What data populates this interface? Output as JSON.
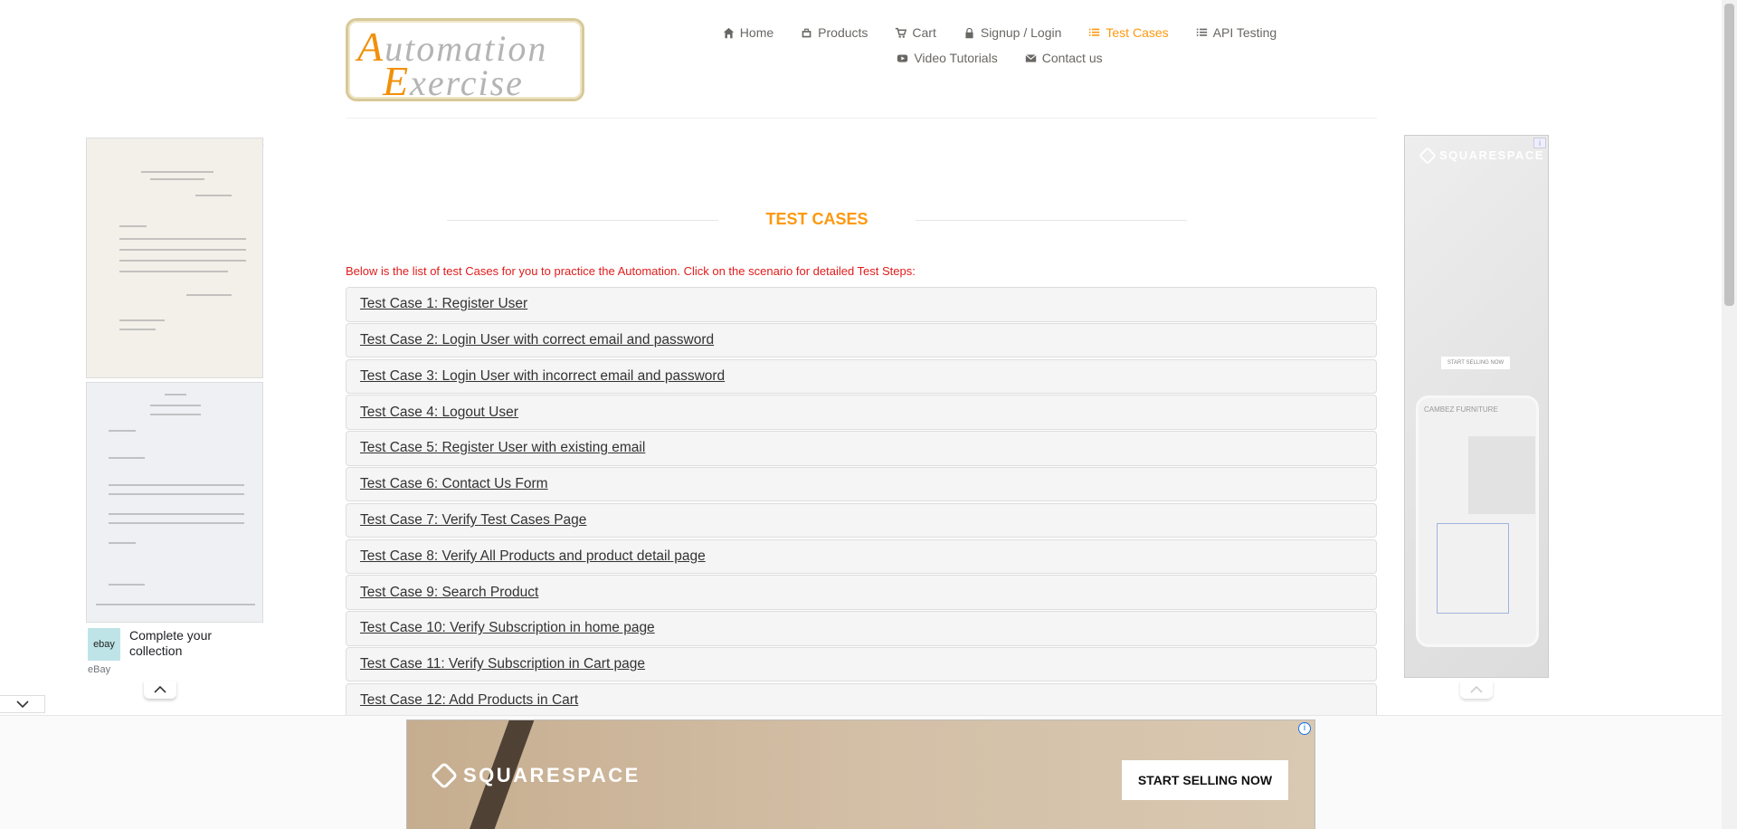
{
  "logo": {
    "line1_cap": "A",
    "line1_rest": "utomation",
    "line2_cap": "E",
    "line2_rest": "xercise"
  },
  "nav": {
    "row1": [
      {
        "label": "Home",
        "icon": "home-icon"
      },
      {
        "label": "Products",
        "icon": "products-icon"
      },
      {
        "label": "Cart",
        "icon": "cart-icon"
      },
      {
        "label": "Signup / Login",
        "icon": "lock-icon"
      },
      {
        "label": "Test Cases",
        "icon": "list-icon",
        "active": true
      },
      {
        "label": "API Testing",
        "icon": "list-icon"
      }
    ],
    "row2": [
      {
        "label": "Video Tutorials",
        "icon": "youtube-icon"
      },
      {
        "label": "Contact us",
        "icon": "envelope-icon"
      }
    ],
    "active_color": "#FE980F"
  },
  "main": {
    "title": "TEST CASES",
    "intro": "Below is the list of test Cases for you to practice the Automation. Click on the scenario for detailed Test Steps:",
    "cases": [
      "Test Case 1: Register User",
      "Test Case 2: Login User with correct email and password",
      "Test Case 3: Login User with incorrect email and password",
      "Test Case 4: Logout User",
      "Test Case 5: Register User with existing email",
      "Test Case 6: Contact Us Form",
      "Test Case 7: Verify Test Cases Page",
      "Test Case 8: Verify All Products and product detail page",
      "Test Case 9: Search Product",
      "Test Case 10: Verify Subscription in home page",
      "Test Case 11: Verify Subscription in Cart page",
      "Test Case 12: Add Products in Cart"
    ]
  },
  "left_ad": {
    "ebay_logo": "ebay",
    "ebay_text": "Complete your collection",
    "ebay_source": "eBay"
  },
  "right_ad": {
    "brand": "SQUARESPACE",
    "button": "START SELLING NOW",
    "phone_title": "CAMBEZ FURNITURE"
  },
  "bottom_ad": {
    "brand": "SQUARESPACE",
    "cta": "START SELLING NOW"
  }
}
